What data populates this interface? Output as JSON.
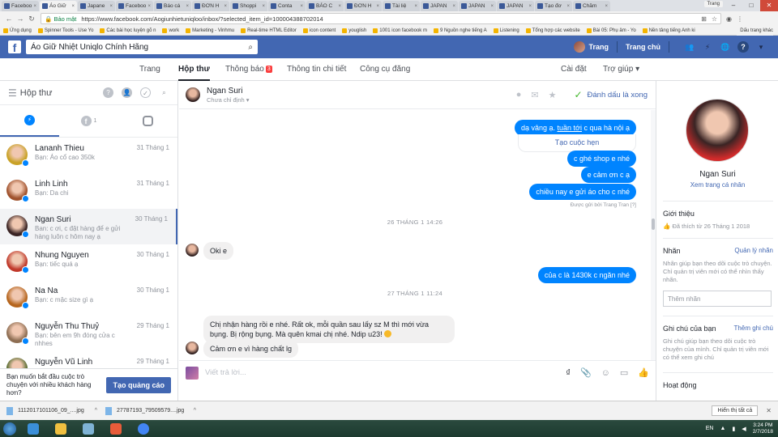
{
  "browser": {
    "tabs": [
      "Faceboo",
      "Áo Giữ",
      "Japane",
      "Faceboo",
      "Báo cá",
      "ĐƠN H",
      "Shoppi",
      "Conta",
      "BÁO C",
      "ĐƠN H",
      "Tài liệ",
      "JAPAN",
      "JAPAN",
      "JAPAN",
      "Tạo đơ",
      "Chăm"
    ],
    "profile_name": "Trang",
    "secure_label": "Bảo mật",
    "url": "https://www.facebook.com/Aogiunhietuniqloo/inbox/?selected_item_id=100004388702014",
    "bookmarks": [
      "Ứng dụng",
      "Spinner Tools - Use Yo",
      "Các bài học luyện gõ n",
      "work",
      "Marketing - Vinhmu",
      "Real-time HTML Editor",
      "icon content",
      "youglish",
      "1001 icon facebook m",
      "9 Nguồn nghe tiếng A",
      "Listening",
      "Tổng hợp các website",
      "Bài 05: Phụ âm - Yo",
      "Nền tảng tiếng Anh ki"
    ],
    "bookmarks_right": "Dấu trang khác"
  },
  "facebook": {
    "search_value": "Áo Giữ Nhiệt Uniqlo Chính Hãng",
    "user_name": "Trang",
    "home_label": "Trang chủ"
  },
  "pagenav": {
    "items": [
      {
        "label": "Trang"
      },
      {
        "label": "Hộp thư"
      },
      {
        "label": "Thông báo",
        "badge": "3"
      },
      {
        "label": "Thông tin chi tiết"
      },
      {
        "label": "Công cụ đăng"
      }
    ],
    "settings": "Cài đặt",
    "help": "Trợ giúp ▾"
  },
  "inbox": {
    "title": "Hộp thư",
    "fb_count": "1",
    "threads": [
      {
        "name": "Lananh Thieu",
        "preview": "Bạn: Áo cổ cao 350k",
        "date": "31 Tháng 1",
        "color": "#c9a227"
      },
      {
        "name": "Linh Linh",
        "preview": "Bạn: Da chi",
        "date": "31 Tháng 1",
        "color": "#a0522d"
      },
      {
        "name": "Ngan Suri",
        "preview": "Ban: c ơi, c đặt hàng để e gửi hàng luôn c hôm nay ạ",
        "date": "30 Tháng 1",
        "color": "#3a2424"
      },
      {
        "name": "Nhung Nguyen",
        "preview": "Bạn: tiếc quá ạ",
        "date": "30 Tháng 1",
        "color": "#c0392b"
      },
      {
        "name": "Na Na",
        "preview": "Bạn: c mặc size gì ạ",
        "date": "30 Tháng 1",
        "color": "#b5651d"
      },
      {
        "name": "Nguyễn Thu Thuỷ",
        "preview": "Bạn: bên em 9h đóng cửa c nhhes",
        "date": "29 Tháng 1",
        "color": "#8e6e53"
      },
      {
        "name": "Nguyễn Vũ Linh",
        "preview": "",
        "date": "29 Tháng 1",
        "color": "#556b2f"
      }
    ],
    "promo_text": "Bạn muốn bắt đầu cuộc trò chuyện với nhiều khách hàng hơn?",
    "promo_button": "Tạo quảng cáo"
  },
  "conversation": {
    "name": "Ngan Suri",
    "status": "Chưa chỉ định ▾",
    "mark_done": "Đánh dấu là xong",
    "msg1_prefix": "dạ vâng ạ. ",
    "msg1_link": "tuần tới",
    "msg1_suffix": " c qua hà nội ạ",
    "reply_card": "Tạo cuộc hẹn",
    "msg2": "c ghé shop e nhé",
    "msg3": "e cảm ơn c ạ",
    "msg4": "chiều nay e gửi áo cho c nhé",
    "sent_by": "Được gửi bởi Trang Tran",
    "sent_by_q": "[?]",
    "divider1": "26 THÁNG 1 14:26",
    "msg5": "Oki e",
    "msg6": "của c là 1430k c ngăn nhé",
    "divider2": "27 THÁNG 1 11:24",
    "msg7": "Chị nhận hàng rồi e nhé. Rất ok, mỗi quần sau lấy sz M thì mới vừa bụng. Bị rộng bụng.  Mà quên kmai chị nhé. Ndip u23!",
    "msg8": "Cảm ơn e vì hàng chất lg",
    "composer_placeholder": "Viết trả lời..."
  },
  "profile": {
    "name": "Ngan Suri",
    "view_link": "Xem trang cá nhân",
    "intro_title": "Giới thiệu",
    "intro_text": "Đã thích từ 26 Tháng 1 2018",
    "labels_title": "Nhãn",
    "labels_action": "Quản lý nhãn",
    "labels_text": "Nhãn giúp bạn theo dõi cuộc trò chuyện. Chỉ quản trị viên mới có thể nhìn thấy nhãn.",
    "labels_placeholder": "Thêm nhãn",
    "notes_title": "Ghi chú của bạn",
    "notes_action": "Thêm ghi chú",
    "notes_text": "Ghi chú giúp bạn theo dõi cuộc trò chuyện của mình. Chỉ quản trị viên mới có thể xem ghi chú",
    "activity_title": "Hoạt động"
  },
  "downloads": {
    "items": [
      "1112017101106_09_....jpg",
      "27787193_79509579....jpg"
    ],
    "show_all": "Hiển thị tất cả"
  },
  "taskbar": {
    "lang": "EN",
    "time": "3:24 PM",
    "date": "2/7/2018"
  },
  "colors": {
    "fb_blue": "#4267b2",
    "messenger_blue": "#0084ff"
  }
}
